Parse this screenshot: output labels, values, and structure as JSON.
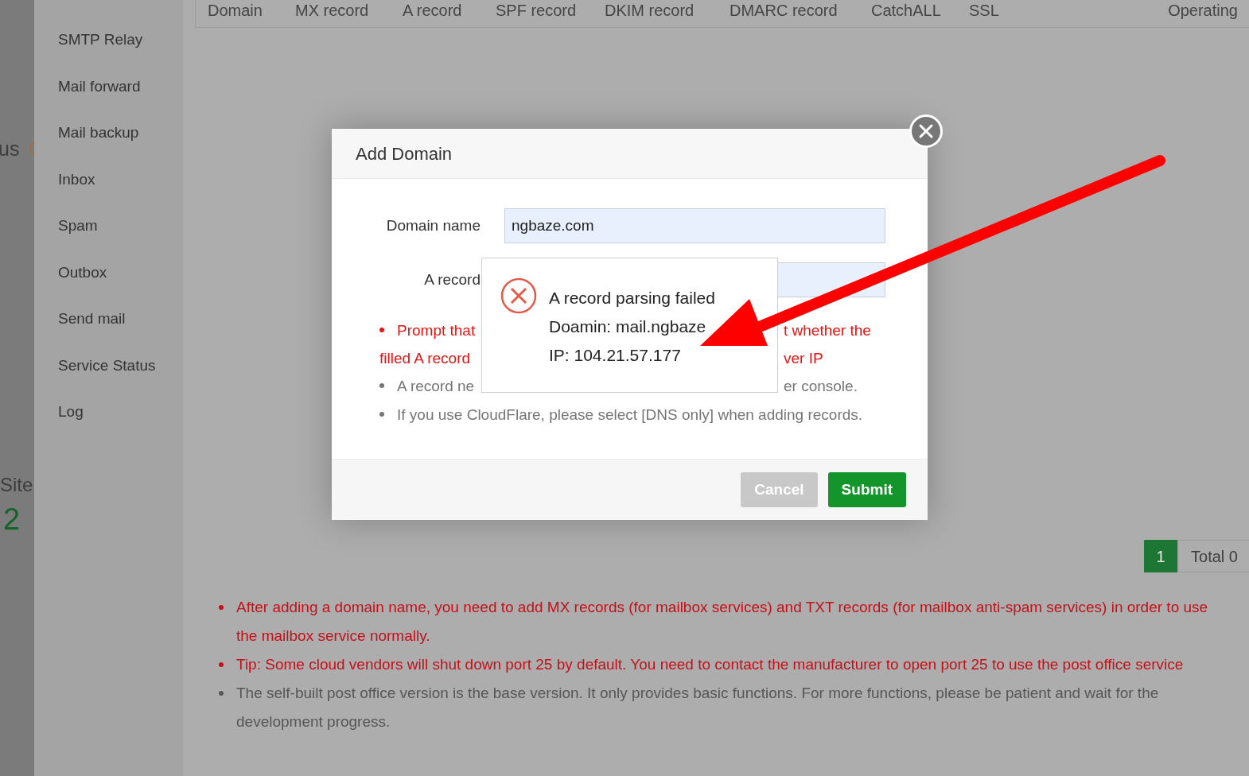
{
  "left_strip": {
    "status_label": "us",
    "site_label": "Site",
    "site_count": "2"
  },
  "sidebar": {
    "items": [
      {
        "label": "SMTP Relay"
      },
      {
        "label": "Mail forward"
      },
      {
        "label": "Mail backup"
      },
      {
        "label": "Inbox"
      },
      {
        "label": "Spam"
      },
      {
        "label": "Outbox"
      },
      {
        "label": "Send mail"
      },
      {
        "label": "Service Status"
      },
      {
        "label": "Log"
      }
    ]
  },
  "table": {
    "columns": [
      "Domain",
      "MX record",
      "A record",
      "SPF record",
      "DKIM record",
      "DMARC record",
      "CatchALL",
      "SSL",
      "Operating"
    ]
  },
  "pagination": {
    "pages": [
      {
        "label": "1",
        "selected": true
      }
    ],
    "total": "Total 0"
  },
  "notes": [
    {
      "kind": "warning",
      "text": "After adding a domain name, you need to add MX records (for mailbox services) and TXT records (for mailbox anti-spam services) in order to use the mailbox service normally."
    },
    {
      "kind": "warning",
      "text": "Tip: Some cloud vendors will shut down port 25 by default. You need to contact the manufacturer to open port 25 to use the post office service"
    },
    {
      "kind": "info",
      "text": "The self-built post office version is the base version. It only provides basic functions. For more functions, please be patient and wait for the development progress."
    }
  ],
  "dialog": {
    "title": "Add Domain",
    "fields": [
      {
        "label": "Domain name",
        "value": "ngbaze.com"
      },
      {
        "label": "A record"
      }
    ],
    "warning_lines": [
      [
        "Prompt that",
        "t whether the"
      ],
      [
        "filled A record",
        "ver IP"
      ]
    ],
    "notes": [
      [
        "A record ne",
        "er console."
      ],
      [
        "If you use CloudFlare, please select [DNS only] when adding records."
      ]
    ],
    "buttons": [
      {
        "label": "Cancel",
        "kind": "secondary"
      },
      {
        "label": "Submit",
        "kind": "primary"
      }
    ]
  },
  "message": {
    "kind": "error",
    "lines": [
      "A record parsing failed",
      "Doamin: mail.ngbaze",
      "IP: 104.21.57.177"
    ]
  }
}
